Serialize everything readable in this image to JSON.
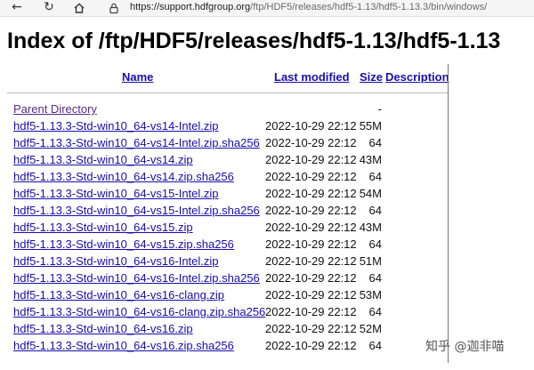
{
  "browser": {
    "url_host": "https://support.hdfgroup.org",
    "url_path": "/ftp/HDF5/releases/hdf5-1.13/hdf5-1.13.3/bin/windows/"
  },
  "page": {
    "title": "Index of /ftp/HDF5/releases/hdf5-1.13/hdf5-1.13",
    "headers": {
      "name": "Name",
      "last_modified": "Last modified",
      "size": "Size",
      "description": "Description"
    },
    "parent": {
      "name": "Parent Directory",
      "size": "-"
    },
    "files": [
      {
        "name": "hdf5-1.13.3-Std-win10_64-vs14-Intel.zip",
        "date": "2022-10-29 22:12",
        "size": "55M"
      },
      {
        "name": "hdf5-1.13.3-Std-win10_64-vs14-Intel.zip.sha256",
        "date": "2022-10-29 22:12",
        "size": "64"
      },
      {
        "name": "hdf5-1.13.3-Std-win10_64-vs14.zip",
        "date": "2022-10-29 22:12",
        "size": "43M"
      },
      {
        "name": "hdf5-1.13.3-Std-win10_64-vs14.zip.sha256",
        "date": "2022-10-29 22:12",
        "size": "64"
      },
      {
        "name": "hdf5-1.13.3-Std-win10_64-vs15-Intel.zip",
        "date": "2022-10-29 22:12",
        "size": "54M"
      },
      {
        "name": "hdf5-1.13.3-Std-win10_64-vs15-Intel.zip.sha256",
        "date": "2022-10-29 22:12",
        "size": "64"
      },
      {
        "name": "hdf5-1.13.3-Std-win10_64-vs15.zip",
        "date": "2022-10-29 22:12",
        "size": "43M"
      },
      {
        "name": "hdf5-1.13.3-Std-win10_64-vs15.zip.sha256",
        "date": "2022-10-29 22:12",
        "size": "64"
      },
      {
        "name": "hdf5-1.13.3-Std-win10_64-vs16-Intel.zip",
        "date": "2022-10-29 22:12",
        "size": "51M"
      },
      {
        "name": "hdf5-1.13.3-Std-win10_64-vs16-Intel.zip.sha256",
        "date": "2022-10-29 22:12",
        "size": "64"
      },
      {
        "name": "hdf5-1.13.3-Std-win10_64-vs16-clang.zip",
        "date": "2022-10-29 22:12",
        "size": "53M"
      },
      {
        "name": "hdf5-1.13.3-Std-win10_64-vs16-clang.zip.sha256",
        "date": "2022-10-29 22:12",
        "size": "64"
      },
      {
        "name": "hdf5-1.13.3-Std-win10_64-vs16.zip",
        "date": "2022-10-29 22:12",
        "size": "52M"
      },
      {
        "name": "hdf5-1.13.3-Std-win10_64-vs16.zip.sha256",
        "date": "2022-10-29 22:12",
        "size": "64"
      }
    ]
  },
  "watermark": "知乎 @迦非喵"
}
